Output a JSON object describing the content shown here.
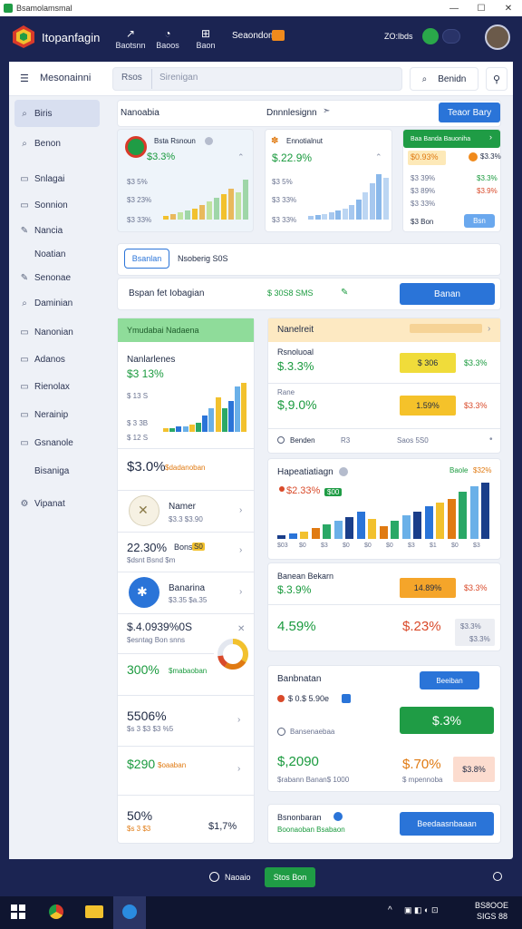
{
  "window": {
    "title": "Bsamolamsmal",
    "min": "—",
    "max": "☐",
    "close": "✕"
  },
  "app": {
    "brand": "Itopanfagin",
    "nav": [
      {
        "icon": "arrow-icon",
        "label": "Baotsnn"
      },
      {
        "icon": "clock-icon",
        "label": "Baoos"
      },
      {
        "icon": "grid-icon",
        "label": "Baon"
      }
    ],
    "highlight_label": "Seaondom",
    "user_id": "ZO:lbds",
    "status_colors": {
      "accent": "#2a74d8",
      "positive": "#1a9a3e",
      "negative": "#d94a2a",
      "warning": "#f2c12e"
    }
  },
  "search": {
    "menu_label": "Mesonainni",
    "filter_label": "Rsos",
    "placeholder": "Sirenigan",
    "search_button": "Benidn"
  },
  "sidebar": {
    "items": [
      {
        "icon": "search-icon",
        "label": "Biris"
      },
      {
        "icon": "search-icon",
        "label": "Benon"
      },
      {
        "icon": "doc-icon",
        "label": "Snlagai"
      },
      {
        "icon": "doc-icon",
        "label": "Sonnion"
      },
      {
        "icon": "pen-icon",
        "label": "Nancia"
      },
      {
        "icon": "",
        "label": "Noatian"
      },
      {
        "icon": "pen-icon",
        "label": "Senonae"
      },
      {
        "icon": "search-icon",
        "label": "Daminian"
      },
      {
        "icon": "doc-icon",
        "label": "Nanonian"
      },
      {
        "icon": "doc-icon",
        "label": "Adanos"
      },
      {
        "icon": "doc-icon",
        "label": "Rienolax"
      },
      {
        "icon": "doc-icon",
        "label": "Nerainip"
      },
      {
        "icon": "doc-icon",
        "label": "Gsnanole"
      },
      {
        "icon": "",
        "label": "Bisaniga"
      },
      {
        "icon": "gear-icon",
        "label": "Vipanat"
      }
    ]
  },
  "header": {
    "left": "Nanoabia",
    "center": "Dnnnlesignn",
    "button": "Teaor Bary"
  },
  "kpi": [
    {
      "title": "Bsta Rsnoun",
      "value": "$3.3%",
      "axis": [
        "$3 5%",
        "$3 23%",
        "$3 33%"
      ]
    },
    {
      "title": "Ennotialnut",
      "value": "$.22.9%",
      "axis": [
        "$3 5%",
        "$3 33%",
        "$3 33%"
      ]
    },
    {
      "header": "Baa Banda Bauoniha",
      "rows": [
        {
          "left": "$0.93%",
          "right": "$3.3%"
        },
        {
          "left": "$3 39%",
          "right": "$3.3%"
        },
        {
          "left": "$3 89%",
          "right": "$3.9%"
        },
        {
          "left": "$3 33%",
          "right": ""
        }
      ],
      "footer": "$3 Bon",
      "button": "Bsn"
    }
  ],
  "tabs": {
    "active": "Bsanlan",
    "other": "Nsoberig S0S"
  },
  "filterrow": {
    "label": "Bspan fet Iobagian",
    "status": "$ 30S8 SMS",
    "button": "Banan"
  },
  "left_panel": {
    "header": "Ymudabai Nadaena",
    "section": "Nanlarlenes",
    "value": "$3 13%",
    "y_axis": [
      "$ 13 S",
      "$ 3 3B",
      "$ 12 S"
    ],
    "stat1": {
      "value": "$3.0%",
      "sub": "$dadanoban"
    },
    "item1": {
      "title": "Namer",
      "sub": "$3.3 $3.90"
    },
    "stat2": {
      "value": "22.30%",
      "label": "Bons",
      "badge": "S0",
      "sub": "$dsnt Bsnd $m"
    },
    "item2": {
      "title": "Banarina",
      "sub": "$3.35 $a.35"
    },
    "stat3": {
      "value": "$.4.0939%0S",
      "sub": "$esntag Bon snns"
    },
    "stat4": {
      "value": "300%",
      "sub": "$mabaoban"
    },
    "stat5": {
      "value": "5506%",
      "sub": "$s 3 $3 $3 %5"
    },
    "stat6": {
      "value": "$290",
      "sub": "$oaaban"
    },
    "stat7": {
      "value": "50%",
      "sub": "$s 3 $3",
      "right": "$1,7%"
    }
  },
  "right_panel": {
    "header": "Nanelreit",
    "section": "Rsnoluoal",
    "value": "$.3.3%",
    "row1": {
      "label": "Rane",
      "value": "$,9.0%",
      "mid": "$ 306",
      "right": "$3.3%"
    },
    "row2": {
      "mid": "1.59%",
      "right": "$3.3%"
    },
    "row3": {
      "a": "Benden",
      "b": "R3",
      "c": "Saos 5S0"
    },
    "chart_title": "Hapeatiatiagn",
    "chart_tag": "Baole",
    "chart_pct": "$32%",
    "chart_values": [
      "$2.33%",
      "$00"
    ],
    "chart_axis": [
      "$03",
      "$0",
      "$3",
      "$0",
      "$0",
      "$0",
      "$3",
      "$1",
      "$0",
      "$3"
    ],
    "summary_title": "Banean Bekarn",
    "summary_value": "$.3.9%",
    "summary_badge": "14.89%",
    "summary_right": "$3.3%",
    "summary2": {
      "left": "4.59%",
      "mid": "$.23%",
      "right1": "$3.3%",
      "right2": "$3.3%"
    },
    "actions_title": "Banbnatan",
    "actions_button": "Beeiban",
    "actions_status": "$ 0.$ 5.90e",
    "actions_option": "Bansenaebaa",
    "actions_big": "$.3%",
    "totals_left": "$,2090",
    "totals_mid": "$.70%",
    "totals_right": "$3.8%",
    "totals_subs": [
      "$rabann Banan$ 1000",
      "$ mpennoba"
    ],
    "footer_title": "Bsnonbaran",
    "footer_sub": "Boonaoban Bsabaon",
    "footer_button": "Beedaasnbaaan"
  },
  "status": {
    "left": "Naoaio",
    "button": "Stos Bon"
  },
  "taskbar": {
    "time": "BS8OOE",
    "date": "SIGS 88"
  }
}
